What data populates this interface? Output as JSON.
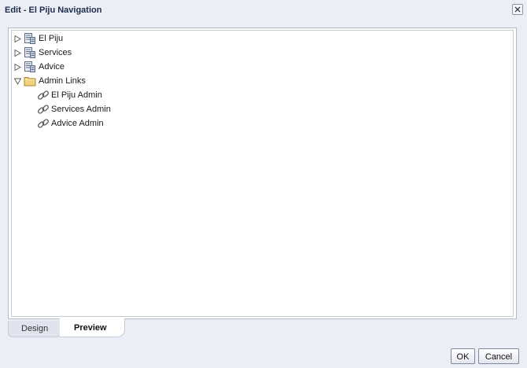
{
  "dialog": {
    "title": "Edit - El Piju Navigation"
  },
  "icons": {
    "close": "close-icon",
    "page": "page-icon",
    "folder": "folder-icon",
    "link": "link-icon",
    "expand": "triangle-right-icon",
    "collapse": "triangle-down-icon"
  },
  "tree": {
    "nodes": [
      {
        "label": "El Piju",
        "type": "page",
        "state": "collapsed"
      },
      {
        "label": "Services",
        "type": "page",
        "state": "collapsed"
      },
      {
        "label": "Advice",
        "type": "page",
        "state": "collapsed"
      },
      {
        "label": "Admin Links",
        "type": "folder",
        "state": "expanded"
      },
      {
        "label": "El Piju Admin",
        "type": "link"
      },
      {
        "label": "Services Admin",
        "type": "link"
      },
      {
        "label": "Advice Admin",
        "type": "link"
      }
    ]
  },
  "tabs": [
    {
      "label": "Design",
      "selected": false
    },
    {
      "label": "Preview",
      "selected": true
    }
  ],
  "buttons": {
    "ok": "OK",
    "cancel": "Cancel"
  },
  "colors": {
    "dialog_bg": "#eceef5",
    "title_text": "#1d2c4c",
    "folder": "#f2d27a"
  }
}
